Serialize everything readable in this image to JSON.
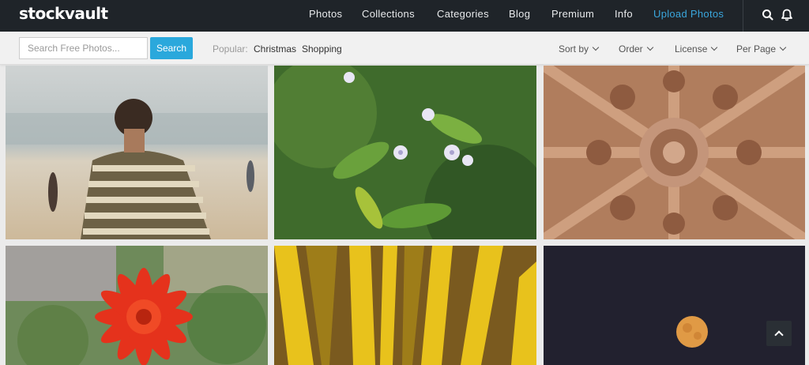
{
  "header": {
    "logo": "stockvault",
    "nav": [
      "Photos",
      "Collections",
      "Categories",
      "Blog",
      "Premium",
      "Info",
      "Upload Photos"
    ]
  },
  "search": {
    "placeholder": "Search Free Photos...",
    "button_label": "Search",
    "popular_label": "Popular:",
    "popular_tags": [
      "Christmas",
      "Shopping"
    ]
  },
  "filters": [
    "Sort by",
    "Order",
    "License",
    "Per Page"
  ],
  "photos": [
    {
      "subject": "man-on-beach"
    },
    {
      "subject": "white-flowers-green-leaves"
    },
    {
      "subject": "carved-stone-wheel"
    },
    {
      "subject": "red-gerbera-flower"
    },
    {
      "subject": "yellow-palm-leaves"
    },
    {
      "subject": "full-moon-night-sky"
    }
  ],
  "colors": {
    "topbar": "#1f2429",
    "accent": "#3aa6dc",
    "search_button": "#2aa8dc"
  }
}
